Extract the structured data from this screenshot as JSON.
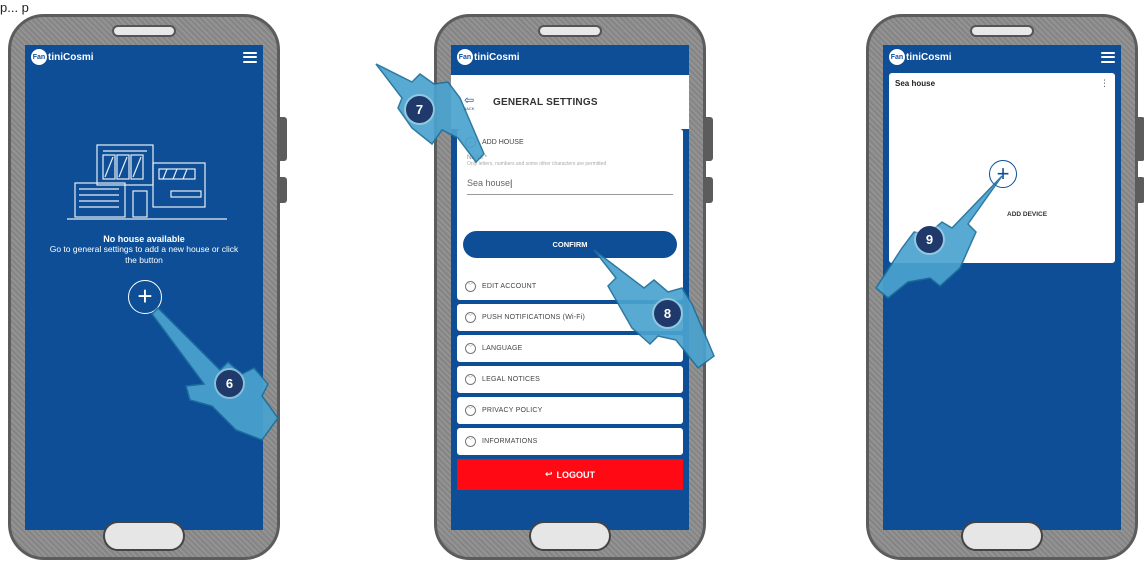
{
  "top_fragment": "p... p",
  "brand": {
    "prefix": "Fan",
    "name": "tiniCosmi"
  },
  "colors": {
    "brand_blue": "#0d4e97",
    "logout_red": "#ff0a14",
    "badge_navy": "#1f3a6a"
  },
  "phone1": {
    "empty_title": "No house available",
    "empty_text": "Go to general settings to add a new house or click the button",
    "add_symbol": "+",
    "step": "6"
  },
  "phone2": {
    "back_label": "BACK",
    "title": "GENERAL SETTINGS",
    "add_house": {
      "label": "ADD HOUSE",
      "field_label": "Name *",
      "hint": "Only letters, numbers and some other characters are permitted",
      "value": "Sea house",
      "confirm": "CONFIRM"
    },
    "items": [
      "EDIT ACCOUNT",
      "PUSH NOTIFICATIONS (Wi-Fi)",
      "LANGUAGE",
      "LEGAL NOTICES",
      "PRIVACY POLICY",
      "INFORMATIONS"
    ],
    "logout": "LOGOUT",
    "steps": [
      "7",
      "8"
    ]
  },
  "phone3": {
    "house_name": "Sea house",
    "kebab": "⋮",
    "add_symbol": "+",
    "add_device": "ADD DEVICE",
    "step": "9"
  },
  "icons": [
    "menu-icon",
    "back-arrow-icon",
    "chevron-icon",
    "plus-icon",
    "logout-icon",
    "hand-pointer-icon",
    "kebab-menu-icon"
  ]
}
